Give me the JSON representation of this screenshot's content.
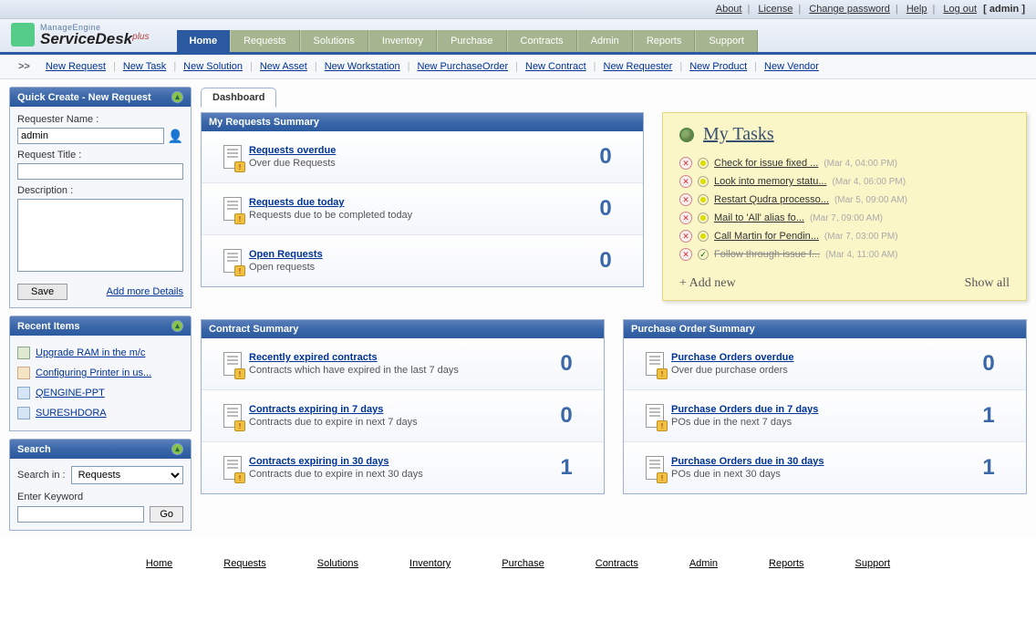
{
  "topbar": {
    "about": "About",
    "license": "License",
    "change_password": "Change password",
    "help": "Help",
    "logout": "Log out",
    "user": "[ admin ]"
  },
  "logo": {
    "line1": "ManageEngine",
    "line2": "ServiceDesk",
    "plus": "plus"
  },
  "tabs": [
    "Home",
    "Requests",
    "Solutions",
    "Inventory",
    "Purchase",
    "Contracts",
    "Admin",
    "Reports",
    "Support"
  ],
  "active_tab": "Home",
  "subnav": [
    "New Request",
    "New Task",
    "New Solution",
    "New Asset",
    "New Workstation",
    "New PurchaseOrder",
    "New Contract",
    "New Requester",
    "New Product",
    "New Vendor"
  ],
  "quick_create": {
    "title": "Quick Create - New Request",
    "requester_label": "Requester Name :",
    "requester_value": "admin",
    "title_label": "Request Title :",
    "title_value": "",
    "desc_label": "Description :",
    "desc_value": "",
    "save": "Save",
    "more": "Add more Details"
  },
  "recent": {
    "title": "Recent Items",
    "items": [
      "Upgrade RAM in the m/c",
      "Configuring Printer in us...",
      "QENGINE-PPT",
      "SURESHDORA"
    ]
  },
  "search": {
    "title": "Search",
    "in_label": "Search in :",
    "in_value": "Requests",
    "kw_label": "Enter Keyword",
    "kw_value": "",
    "go": "Go"
  },
  "dashboard_tab": "Dashboard",
  "requests_widget": {
    "title": "My Requests Summary",
    "rows": [
      {
        "title": "Requests overdue",
        "sub": "Over due Requests",
        "count": "0"
      },
      {
        "title": "Requests due today",
        "sub": "Requests due to be completed today",
        "count": "0"
      },
      {
        "title": "Open Requests",
        "sub": "Open requests",
        "count": "0"
      }
    ]
  },
  "tasks": {
    "title": "My Tasks",
    "add": "+ Add new",
    "showall": "Show all",
    "items": [
      {
        "text": "Check for issue fixed ...",
        "time": "(Mar 4, 04:00 PM)",
        "done": false
      },
      {
        "text": "Look into memory statu...",
        "time": "(Mar 4, 06:00 PM)",
        "done": false
      },
      {
        "text": "Restart Qudra processo...",
        "time": "(Mar 5, 09:00 AM)",
        "done": false
      },
      {
        "text": "Mail to 'All' alias fo...",
        "time": "(Mar 7, 09:00 AM)",
        "done": false
      },
      {
        "text": "Call Martin for Pendin...",
        "time": "(Mar 7, 03:00 PM)",
        "done": false
      },
      {
        "text": "Follow through issue f...",
        "time": "(Mar 4, 11:00 AM)",
        "done": true
      }
    ]
  },
  "contract_widget": {
    "title": "Contract Summary",
    "rows": [
      {
        "title": "Recently expired contracts",
        "sub": "Contracts which have expired in the last 7 days",
        "count": "0"
      },
      {
        "title": "Contracts expiring in 7 days",
        "sub": "Contracts due to expire in next 7 days",
        "count": "0"
      },
      {
        "title": "Contracts expiring in 30 days",
        "sub": "Contracts due to expire in next 30 days",
        "count": "1"
      }
    ]
  },
  "po_widget": {
    "title": "Purchase Order Summary",
    "rows": [
      {
        "title": "Purchase Orders overdue",
        "sub": "Over due purchase orders",
        "count": "0"
      },
      {
        "title": "Purchase Orders due in 7 days",
        "sub": "POs due in the next 7 days",
        "count": "1"
      },
      {
        "title": "Purchase Orders due in 30 days",
        "sub": "POs due in next 30 days",
        "count": "1"
      }
    ]
  },
  "footer": [
    "Home",
    "Requests",
    "Solutions",
    "Inventory",
    "Purchase",
    "Contracts",
    "Admin",
    "Reports",
    "Support"
  ]
}
